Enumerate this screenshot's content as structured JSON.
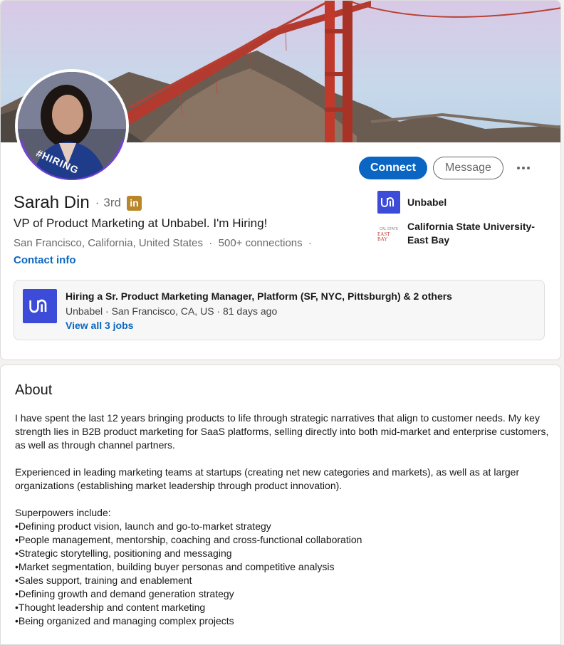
{
  "profile": {
    "name": "Sarah Din",
    "degree_sep": "·",
    "degree": "3rd",
    "linkedin_badge": "in",
    "headline": "VP of Product Marketing at Unbabel. I'm Hiring!",
    "location": "San Francisco, California, United States",
    "connections": "500+ connections",
    "contact_label": "Contact info",
    "avatar_frame_text": "#HIRING"
  },
  "actions": {
    "connect_label": "Connect",
    "message_label": "Message"
  },
  "organizations": [
    {
      "name": "Unbabel",
      "logo": "unbabel-logo"
    },
    {
      "name": "California State University-East Bay",
      "logo": "csu-logo",
      "logo_text": "EAST BAY"
    }
  ],
  "hiring": {
    "title": "Hiring a Sr. Product Marketing Manager, Platform (SF, NYC, Pittsburgh) & 2 others",
    "subtitle": "Unbabel · San Francisco, CA, US · 81 days ago",
    "link": "View all 3 jobs"
  },
  "about": {
    "title": "About",
    "paragraphs": [
      "I have spent the last 12 years bringing products to life through strategic narratives that align to customer needs. My key strength lies in B2B product marketing for SaaS platforms, selling directly into both mid-market and enterprise customers, as well as through channel partners.",
      "Experienced in leading marketing teams at startups (creating net new categories and markets), as well as at larger organizations (establishing market leadership through product innovation)."
    ],
    "superpowers_label": "Superpowers include:",
    "superpowers": [
      "Defining product vision, launch and go-to-market strategy",
      "People management, mentorship, coaching and cross-functional collaboration",
      "Strategic storytelling, positioning and messaging",
      "Market segmentation, building buyer personas and competitive analysis",
      "Sales support, training and enablement",
      "Defining growth and demand generation strategy",
      "Thought leadership and content marketing",
      "Being organized and managing complex projects"
    ]
  },
  "colors": {
    "primary": "#0a66c2",
    "hiring_ring": "#7b3fe0",
    "unbabel_brand": "#3c4bd8"
  }
}
